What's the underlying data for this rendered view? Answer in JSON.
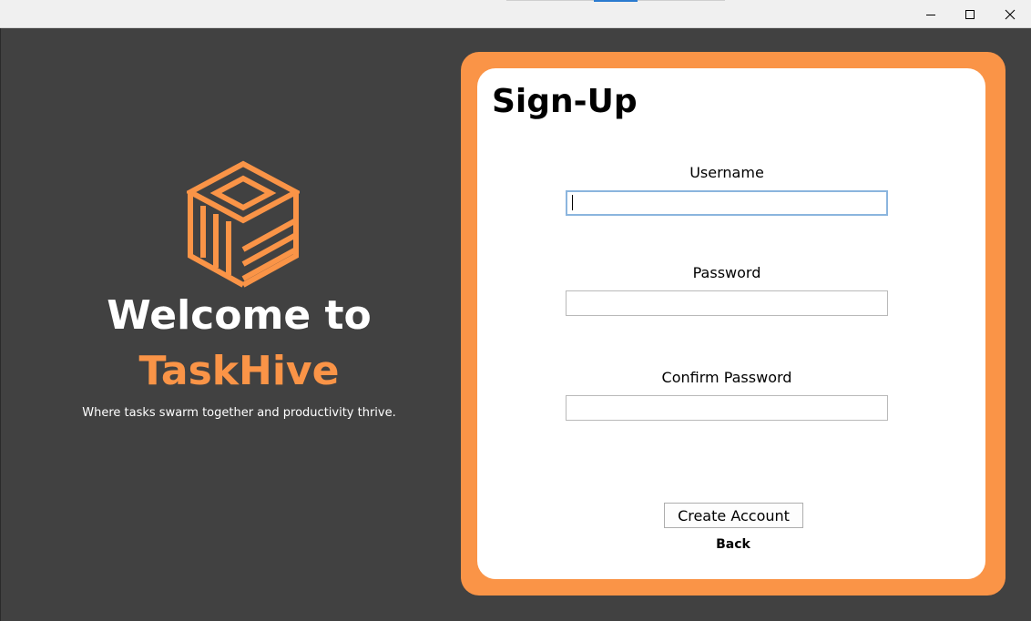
{
  "window": {
    "controls": {
      "minimize_icon": "minimize-icon",
      "maximize_icon": "maximize-icon",
      "close_icon": "close-icon"
    }
  },
  "branding": {
    "logo_icon": "taskhive-cube-logo",
    "welcome_text": "Welcome to",
    "brand_name": "TaskHive",
    "tagline": "Where tasks swarm together and productivity thrive."
  },
  "signup": {
    "title": "Sign-Up",
    "fields": [
      {
        "label": "Username",
        "value": "",
        "placeholder": ""
      },
      {
        "label": "Password",
        "value": "",
        "placeholder": ""
      },
      {
        "label": "Confirm Password",
        "value": "",
        "placeholder": ""
      }
    ],
    "create_button_label": "Create Account",
    "back_label": "Back"
  },
  "colors": {
    "background": "#414141",
    "accent": "#fa9447",
    "card": "#ffffff",
    "focus_border": "#8bb5de"
  }
}
